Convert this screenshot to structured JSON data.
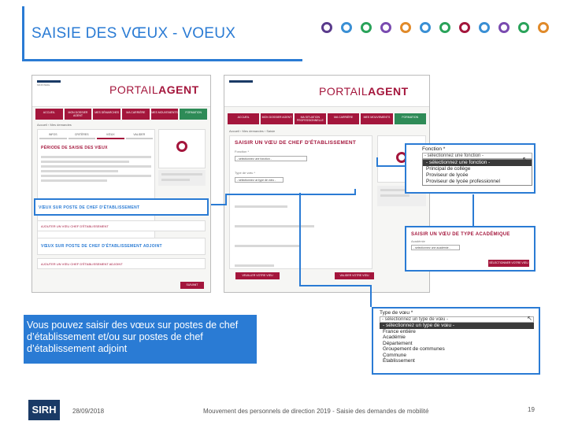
{
  "slide": {
    "title": "SAISIE DES VŒUX - VOEUX",
    "callout": "Vous pouvez saisir des vœux sur postes de chef d’établissement et/ou sur postes de chef d’établissement adjoint",
    "footer_logo": "SIRH",
    "footer_date": "28/09/2018",
    "footer_center": "Mouvement des personnels de direction 2019 - Saisie des demandes de mobilité",
    "page_number": "19"
  },
  "logos": [
    {
      "color": "#5a3b8c"
    },
    {
      "color": "#3a8fd4"
    },
    {
      "color": "#2aa35a"
    },
    {
      "color": "#7a4bb0"
    },
    {
      "color": "#e08a2a"
    },
    {
      "color": "#3a8fd4"
    },
    {
      "color": "#2aa35a"
    },
    {
      "color": "#a4163c"
    },
    {
      "color": "#3a8fd4"
    },
    {
      "color": "#7a4bb0"
    },
    {
      "color": "#2aa35a"
    },
    {
      "color": "#e08a2a"
    }
  ],
  "portal_left": {
    "brand_a": "PORTAIL",
    "brand_b": "AGENT",
    "nav": [
      "ACCUEIL",
      "MON DOSSIER AGENT",
      "MES DÉMARCHES",
      "MA CARRIÈRE",
      "MES MOUVEMENTS",
      "FORMATION"
    ],
    "heading": "PÉRIODE DE SAISIE DES VŒUX",
    "section1": "VŒUX SUR POSTE DE CHEF D'ÉTABLISSEMENT",
    "add1": "AJOUTER UN VŒU CHEF D'ÉTABLISSEMENT",
    "section2": "VŒUX SUR POSTE DE CHEF D'ÉTABLISSEMENT ADJOINT",
    "add2": "AJOUTER UN VŒU CHEF D'ÉTABLISSEMENT ADJOINT",
    "tabs": [
      "INFOS",
      "CRITÈRES",
      "VŒUX",
      "VALIDER"
    ],
    "next_btn": "SUIVANT"
  },
  "portal_right": {
    "brand_a": "PORTAIL",
    "brand_b": "AGENT",
    "nav": [
      "ACCUEIL",
      "MON DOSSIER AGENT",
      "MA SITUATION PROFESSIONNELLE",
      "MA CARRIÈRE",
      "MES MOUVEMENTS",
      "FORMATION"
    ],
    "heading": "SAISIR UN VŒU DE CHEF D'ÉTABLISSEMENT",
    "fonction_label": "Fonction *",
    "fonction_value": "- sélectionnez une fonction -",
    "type_label": "Type de vœu *",
    "type_value": "- sélectionnez un type de vœu -",
    "validate_btn": "VEUILLER VOTRE VŒU",
    "validate_btn2": "VALIDER VOTRE VŒU"
  },
  "dropdown_fonction": {
    "label": "Fonction *",
    "current": "- sélectionnez une fonction -",
    "options": [
      "- sélectionnez une fonction -",
      "Principal de collège",
      "Proviseur de lycée",
      "Proviseur de lycée professionnel"
    ]
  },
  "academie_panel": {
    "heading": "SAISIR UN VŒU DE TYPE ACADÉMIQUE",
    "label": "Académie",
    "value": "- sélectionnez une académie -",
    "button": "SÉLECTIONNER VOTRE VŒU"
  },
  "dropdown_type": {
    "label": "Type de vœu *",
    "current": "- sélectionnez un type de vœu -",
    "options": [
      "- sélectionnez un type de vœu -",
      "France entière",
      "Académie",
      "Département",
      "Groupement de communes",
      "Commune",
      "Établissement"
    ]
  }
}
